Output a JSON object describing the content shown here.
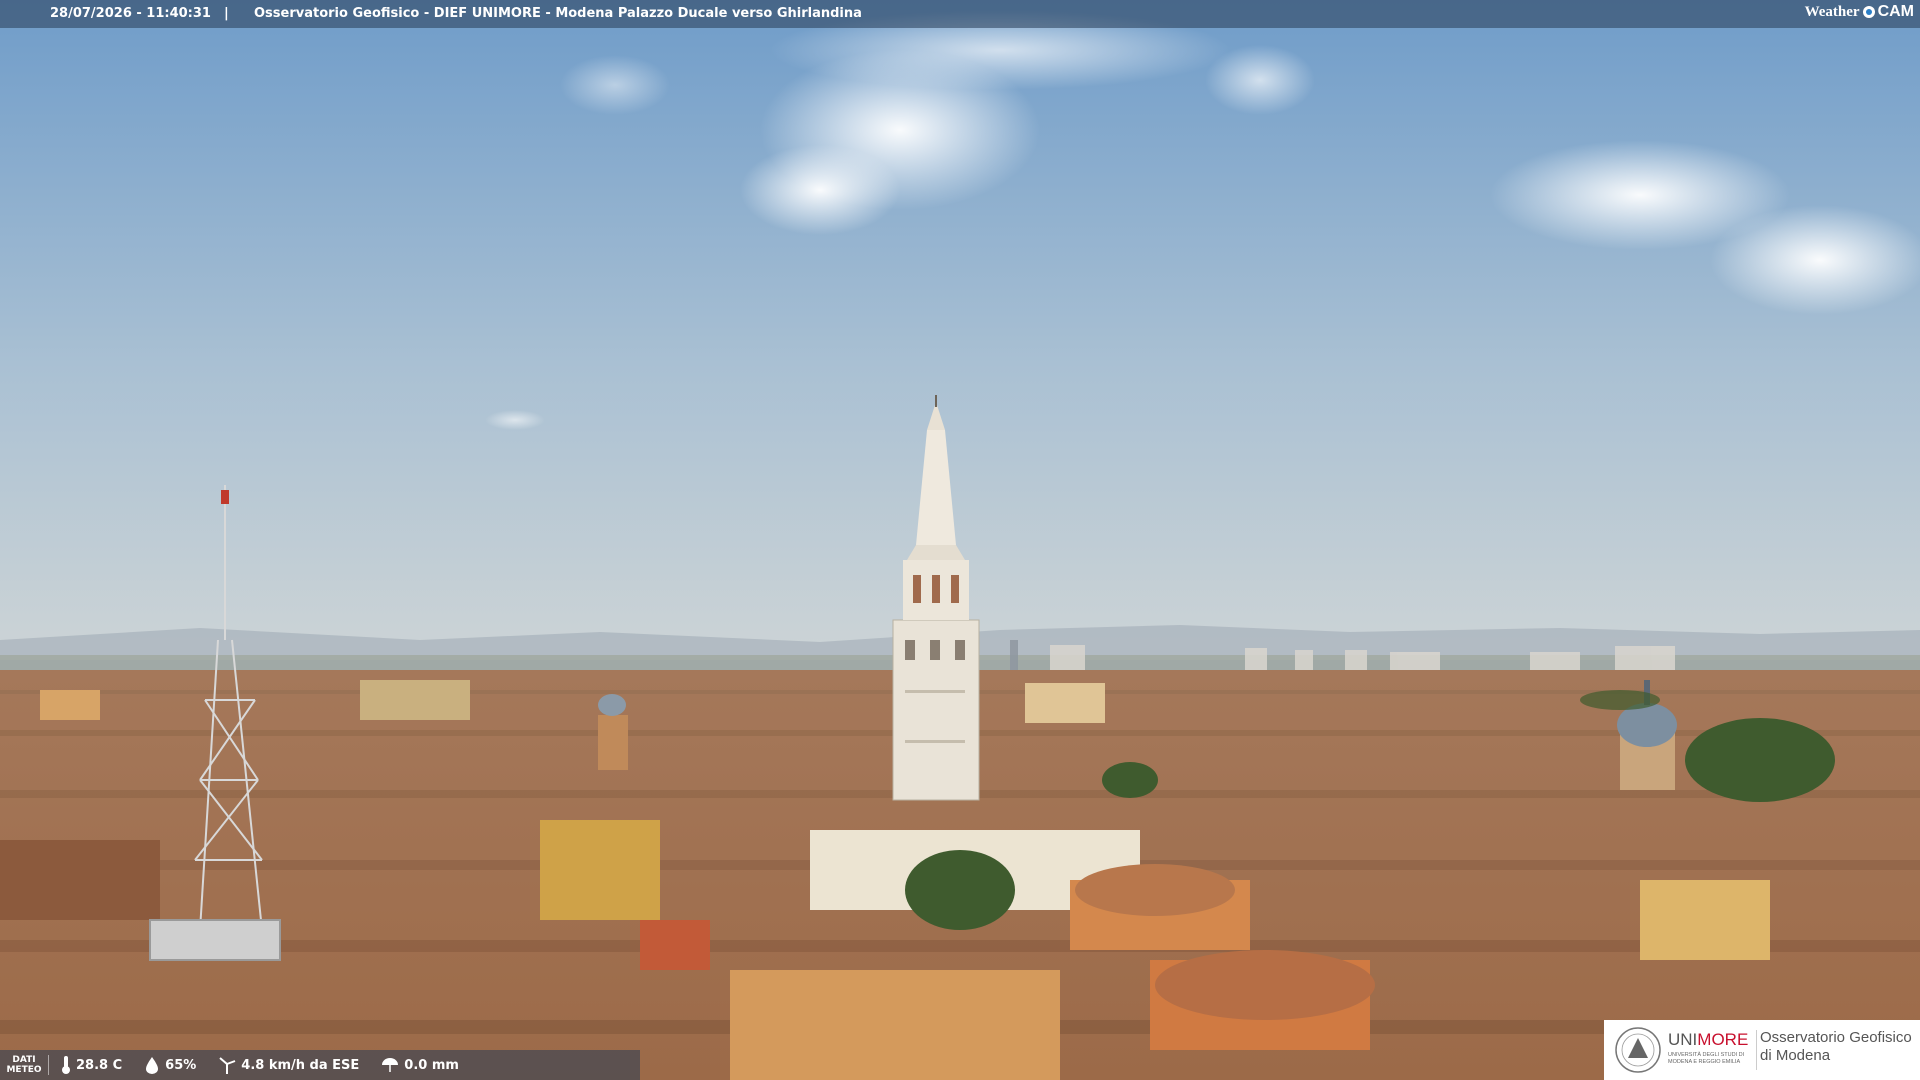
{
  "overlay": {
    "timestamp": "28/07/2026 - 11:40:31",
    "separator": "|",
    "title": "Osservatorio Geofisico - DIEF UNIMORE - Modena Palazzo Ducale verso Ghirlandina"
  },
  "brand": {
    "weather": "Weather",
    "cam": "CAM",
    "icon": "weathercam-logo-icon"
  },
  "meteo": {
    "label_line1": "DATI",
    "label_line2": "METEO",
    "temperature": "28.8 C",
    "humidity": "65%",
    "wind": "4.8 km/h da ESE",
    "rain": "0.0 mm",
    "icons": [
      "thermometer-icon",
      "humidity-drop-icon",
      "wind-turbine-icon",
      "rain-umbrella-icon"
    ]
  },
  "logo": {
    "uni_a": "UNI",
    "uni_b": "MORE",
    "uni_sub": "UNIVERSITÀ DEGLI STUDI DI MODENA E REGGIO EMILIA",
    "obs_line1": "Osservatorio Geofisico",
    "obs_line2": "di Modena"
  },
  "colors": {
    "sky_top": "#7da6cf",
    "sky_horizon": "#c9d3d9",
    "roof": "#b77e56",
    "tower": "#ece6da",
    "overlay_bar": "#283c55",
    "unimore_red": "#c8102e"
  }
}
